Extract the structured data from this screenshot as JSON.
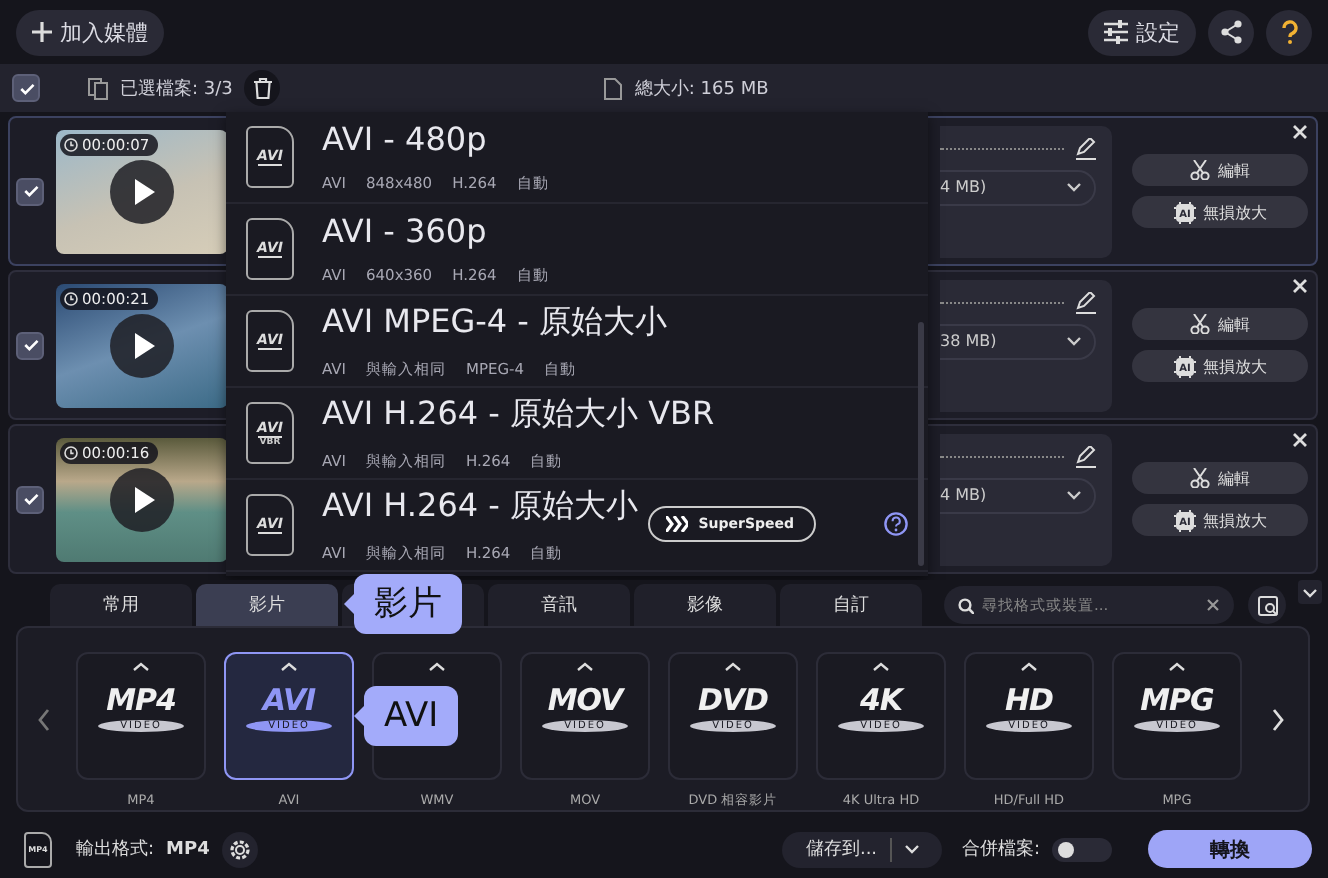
{
  "top_bar": {
    "add_button": "加入媒體",
    "settings_button": "設定"
  },
  "file_toolbar": {
    "all_checked": true,
    "selected_count": "已選檔案: 3/3",
    "total_size": "總大小: 165 MB"
  },
  "files": [
    {
      "checked": true,
      "duration": "00:00:07",
      "size_text": "4 MB)",
      "edit_button": "編輯",
      "upscale_icon_text": "AI",
      "upscale_button": "無損放大"
    },
    {
      "checked": true,
      "duration": "00:00:21",
      "size_text": "38 MB)",
      "edit_button": "編輯",
      "upscale_icon_text": "AI",
      "upscale_button": "無損放大"
    },
    {
      "checked": true,
      "duration": "00:00:16",
      "size_text": "4 MB)",
      "edit_button": "編輯",
      "upscale_icon_text": "AI",
      "upscale_button": "無損放大"
    }
  ],
  "preset_menu": {
    "presets": [
      {
        "icon_text": "AVI",
        "title": "AVI - 480p",
        "details": [
          "AVI",
          "848x480",
          "H.264",
          "自動"
        ]
      },
      {
        "icon_text": "AVI",
        "title": "AVI - 360p",
        "details": [
          "AVI",
          "640x360",
          "H.264",
          "自動"
        ]
      },
      {
        "icon_text": "AVI",
        "title": "AVI MPEG-4 - 原始大小",
        "details": [
          "AVI",
          "與輸入相同",
          "MPEG-4",
          "自動"
        ]
      },
      {
        "icon_text": "AVI",
        "icon_subtext": "VBR",
        "title": "AVI H.264 - 原始大小 VBR",
        "details": [
          "AVI",
          "與輸入相同",
          "H.264",
          "自動"
        ]
      },
      {
        "icon_text": "AVI",
        "title": "AVI H.264 - 原始大小",
        "details": [
          "AVI",
          "與輸入相同",
          "H.264",
          "自動"
        ],
        "superspeed": "SuperSpeed"
      }
    ]
  },
  "format_panel": {
    "tabs": [
      {
        "label": "常用",
        "selected": false
      },
      {
        "label": "影片",
        "selected": true
      },
      {
        "selected": false
      },
      {
        "label": "音訊",
        "selected": false
      },
      {
        "label": "影像",
        "selected": false
      },
      {
        "label": "自訂",
        "selected": false
      }
    ],
    "search": {
      "placeholder": "尋找格式或裝置..."
    },
    "formats": [
      {
        "logo": "MP4",
        "logo_sub": "VIDEO",
        "label": "MP4",
        "selected": false
      },
      {
        "logo": "AVI",
        "logo_sub": "VIDEO",
        "label": "AVI",
        "selected": true
      },
      {
        "label": "WMV",
        "selected": false
      },
      {
        "logo": "MOV",
        "logo_sub": "VIDEO",
        "label": "MOV",
        "selected": false
      },
      {
        "logo": "DVD",
        "logo_sub": "VIDEO",
        "label": "DVD 相容影片",
        "selected": false
      },
      {
        "logo": "4K",
        "logo_sub": "VIDEO",
        "label": "4K Ultra HD",
        "selected": false
      },
      {
        "logo": "HD",
        "logo_sub": "VIDEO",
        "label": "HD/Full HD",
        "selected": false
      },
      {
        "logo": "MPG",
        "logo_sub": "VIDEO",
        "label": "MPG",
        "selected": false
      }
    ]
  },
  "callouts": [
    {
      "text": "影片"
    },
    {
      "text": "AVI"
    }
  ],
  "bottom_bar": {
    "output_icon_text": "MP4",
    "output_label": "輸出格式:",
    "output_value": "MP4",
    "save_to": "儲存到...",
    "merge_label": "合併檔案:",
    "merge_on": false,
    "convert_button": "轉換"
  }
}
